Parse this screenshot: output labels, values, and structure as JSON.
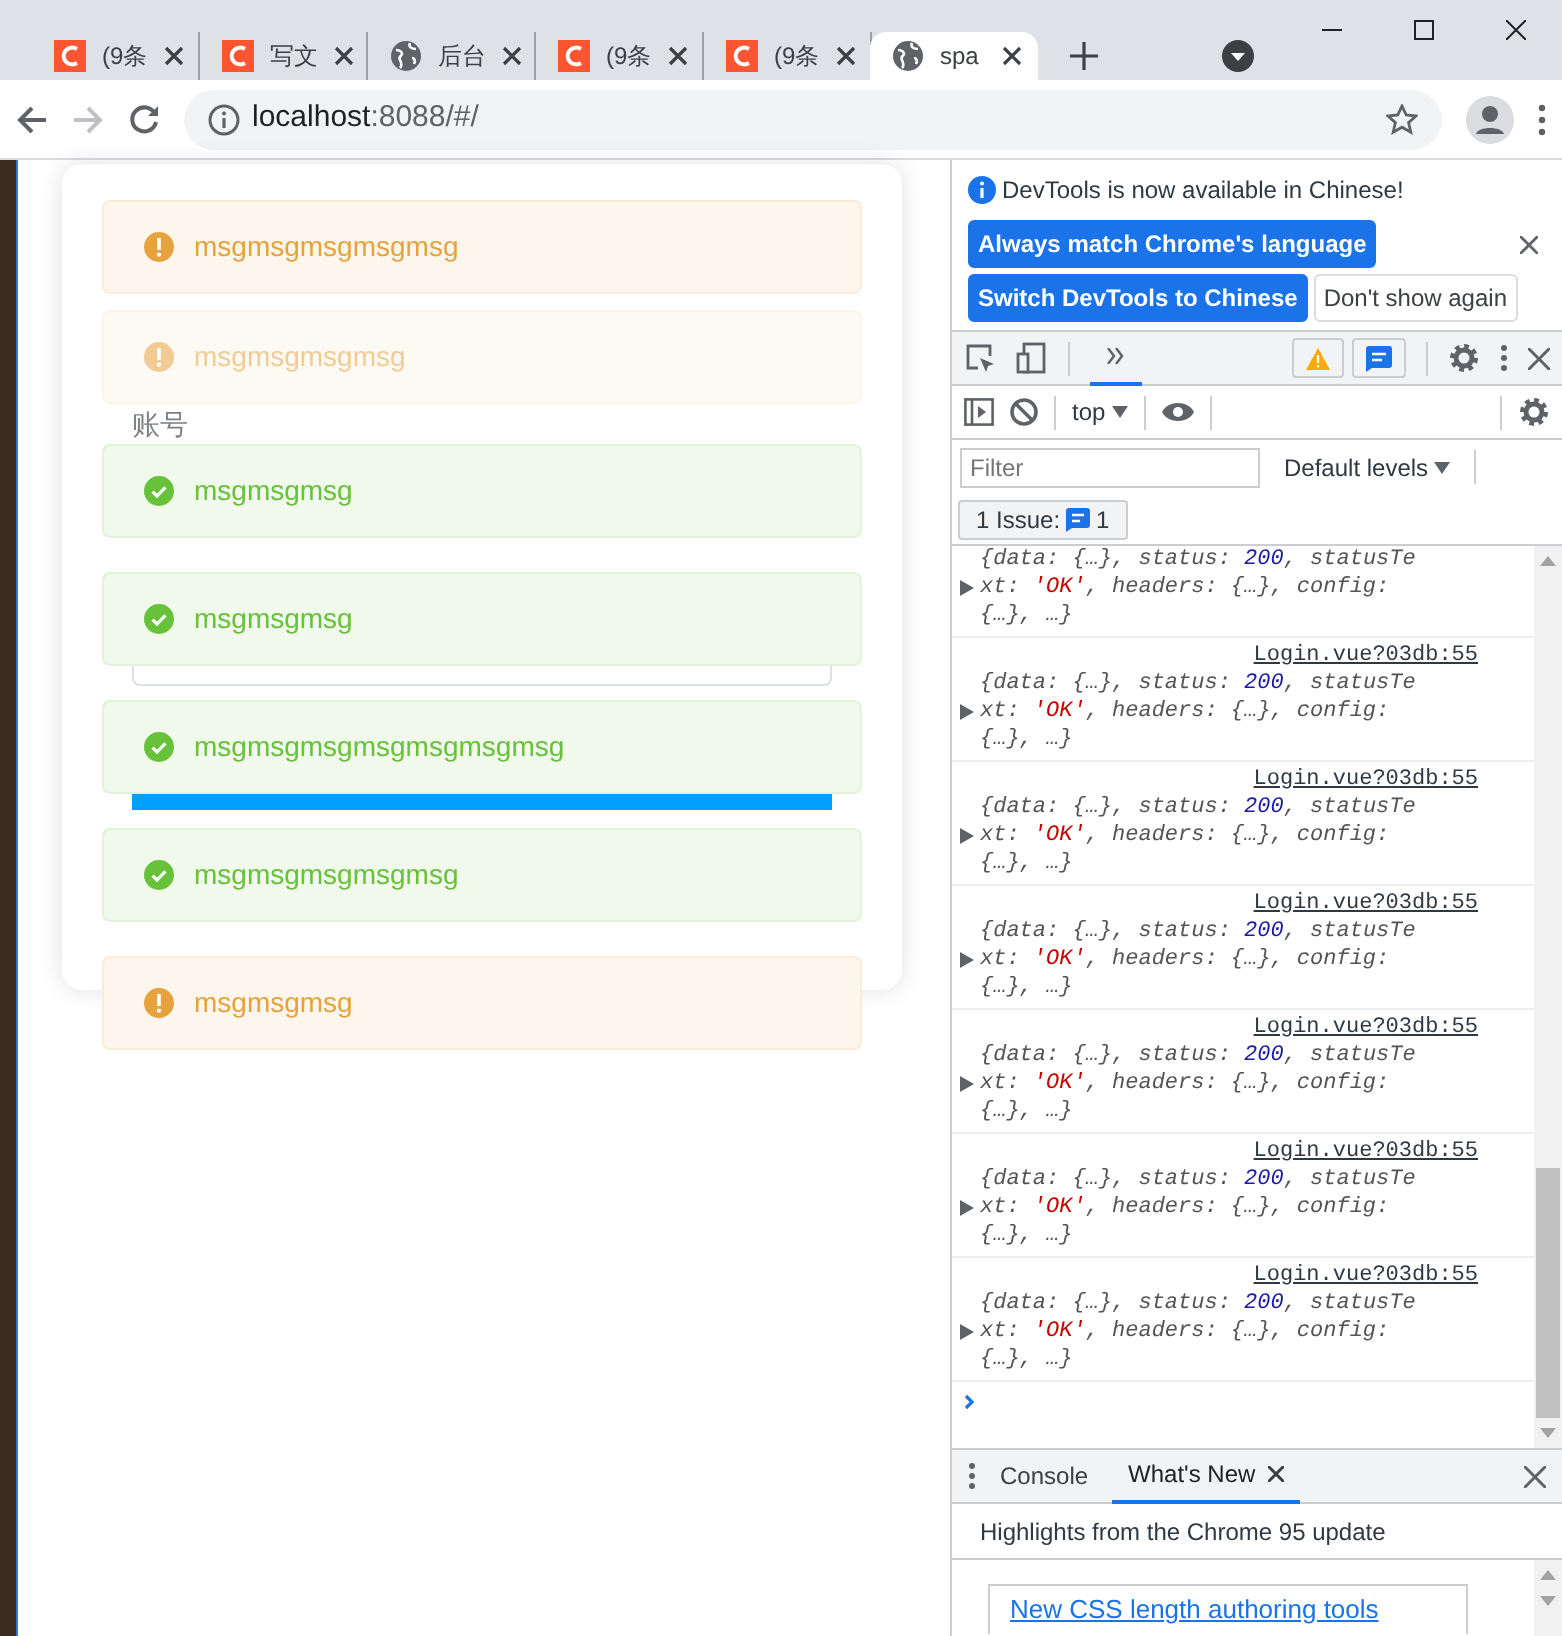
{
  "browser": {
    "tabs": [
      {
        "title": "(9条",
        "kind": "logo",
        "selected": false
      },
      {
        "title": "写文",
        "kind": "logo",
        "selected": false
      },
      {
        "title": "后台",
        "kind": "globe",
        "selected": false
      },
      {
        "title": "(9条",
        "kind": "logo",
        "selected": false
      },
      {
        "title": "(9条",
        "kind": "logo",
        "selected": false
      },
      {
        "title": "spa",
        "kind": "globe",
        "selected": true
      }
    ],
    "forward_button": {
      "disabled": true
    },
    "address": {
      "host": "localhost",
      "rest": ":8088/#/"
    }
  },
  "page": {
    "form": {
      "account_label": "账号"
    },
    "messages": [
      {
        "kind": "warning",
        "text": "msgmsgmsgmsgmsg",
        "fading": false
      },
      {
        "kind": "warning",
        "text": "msgmsgmsgmsg",
        "fading": true
      },
      {
        "kind": "success",
        "text": "msgmsgmsg",
        "fading": false
      },
      {
        "kind": "success",
        "text": "msgmsgmsg",
        "fading": false
      },
      {
        "kind": "success",
        "text": "msgmsgmsgmsgmsgmsgmsg",
        "fading": false
      },
      {
        "kind": "success",
        "text": "msgmsgmsgmsgmsg",
        "fading": false
      },
      {
        "kind": "warning",
        "text": "msgmsgmsg",
        "fading": false
      }
    ]
  },
  "devtools": {
    "banner": {
      "text": "DevTools is now available in Chinese!",
      "buttons": [
        {
          "label": "Always match Chrome's language",
          "primary": true
        },
        {
          "label": "Switch DevTools to Chinese",
          "primary": true
        },
        {
          "label": "Don't show again",
          "primary": false
        }
      ]
    },
    "panel_tabs": [
      {
        "selected": true
      }
    ],
    "context": "top",
    "filter": {
      "placeholder": "Filter"
    },
    "levels": "Default levels",
    "issues": {
      "label": "1 Issue:",
      "count": "1"
    },
    "logs": [
      {
        "parts": [
          {
            "text": "{data: {…}, status: ",
            "kind": "plain"
          },
          {
            "text": "200",
            "kind": "number"
          },
          {
            "text": ", statusText: ",
            "kind": "plain"
          },
          {
            "text": "'OK'",
            "kind": "string"
          },
          {
            "text": ", headers: {…}, config: {…}, …}",
            "kind": "plain"
          }
        ]
      },
      {
        "source": "Login.vue?03db:55",
        "parts": [
          {
            "text": "{data: {…}, status: ",
            "kind": "plain"
          },
          {
            "text": "200",
            "kind": "number"
          },
          {
            "text": ", statusText: ",
            "kind": "plain"
          },
          {
            "text": "'OK'",
            "kind": "string"
          },
          {
            "text": ", headers: {…}, config: {…}, …}",
            "kind": "plain"
          }
        ]
      },
      {
        "source": "Login.vue?03db:55",
        "parts": [
          {
            "text": "{data: {…}, status: ",
            "kind": "plain"
          },
          {
            "text": "200",
            "kind": "number"
          },
          {
            "text": ", statusText: ",
            "kind": "plain"
          },
          {
            "text": "'OK'",
            "kind": "string"
          },
          {
            "text": ", headers: {…}, config: {…}, …}",
            "kind": "plain"
          }
        ]
      },
      {
        "source": "Login.vue?03db:55",
        "parts": [
          {
            "text": "{data: {…}, status: ",
            "kind": "plain"
          },
          {
            "text": "200",
            "kind": "number"
          },
          {
            "text": ", statusText: ",
            "kind": "plain"
          },
          {
            "text": "'OK'",
            "kind": "string"
          },
          {
            "text": ", headers: {…}, config: {…}, …}",
            "kind": "plain"
          }
        ]
      },
      {
        "source": "Login.vue?03db:55",
        "parts": [
          {
            "text": "{data: {…}, status: ",
            "kind": "plain"
          },
          {
            "text": "200",
            "kind": "number"
          },
          {
            "text": ", statusText: ",
            "kind": "plain"
          },
          {
            "text": "'OK'",
            "kind": "string"
          },
          {
            "text": ", headers: {…}, config: {…}, …}",
            "kind": "plain"
          }
        ]
      },
      {
        "source": "Login.vue?03db:55",
        "parts": [
          {
            "text": "{data: {…}, status: ",
            "kind": "plain"
          },
          {
            "text": "200",
            "kind": "number"
          },
          {
            "text": ", statusText: ",
            "kind": "plain"
          },
          {
            "text": "'OK'",
            "kind": "string"
          },
          {
            "text": ", headers: {…}, config: {…}, …}",
            "kind": "plain"
          }
        ]
      },
      {
        "source": "Login.vue?03db:55",
        "parts": [
          {
            "text": "{data: {…}, status: ",
            "kind": "plain"
          },
          {
            "text": "200",
            "kind": "number"
          },
          {
            "text": ", statusText: ",
            "kind": "plain"
          },
          {
            "text": "'OK'",
            "kind": "string"
          },
          {
            "text": ", headers: {…}, config: {…}, …}",
            "kind": "plain"
          }
        ]
      }
    ],
    "drawer": {
      "tabs": [
        {
          "label": "Console",
          "selected": false,
          "closable": false
        },
        {
          "label": "What's New",
          "selected": true,
          "closable": true
        }
      ],
      "headline": "Highlights from the Chrome 95 update",
      "link": "New CSS length authoring tools"
    }
  }
}
